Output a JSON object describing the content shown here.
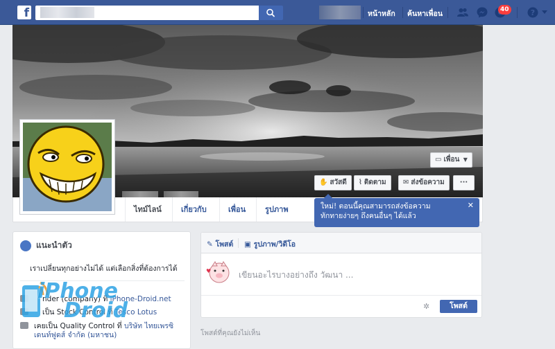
{
  "topbar": {
    "logo": "f",
    "home": "หน้าหลัก",
    "find_friends": "ค้นหาเพื่อน",
    "notifications_count": "40",
    "icons": [
      "friend-requests-icon",
      "messenger-icon",
      "notifications-icon",
      "help-icon"
    ]
  },
  "cover": {
    "friend_button": "เพื่อน",
    "wave_button": "สวัสดี",
    "follow_button": "ติดตาม",
    "message_button": "ส่งข้อความ",
    "more_button": "···"
  },
  "timeline_nav": {
    "items": [
      "ไทม์ไลน์",
      "เกี่ยวกับ",
      "เพื่อน",
      "รูปภาพ"
    ]
  },
  "tooltip": {
    "text_line1": "ใหม่! ตอนนี้คุณสามารถส่งข้อความ",
    "text_line2": "ทักทายง่ายๆ ถึงคนอื่นๆ ได้แล้ว",
    "close": "✕"
  },
  "intro": {
    "title": "แนะนำตัว",
    "bio": "เราเปลี่ยนทุกอย่างไม่ได้ แต่เลือกสิ่งที่ต้องการได้",
    "line1_prefix": "nder (company) ที่",
    "line1_link": "iPhone-Droid.net",
    "line2_prefix": "เป็น Stock Control ที่",
    "line2_link": "Tesco Lotus",
    "line3_prefix": "เคยเป็น Quality Control ที่",
    "line3_link": "บริษัท ไทยเพรซิ",
    "line4": "เดนท์ฟูดส์ จำกัด (มหาชน)"
  },
  "composer": {
    "tab_post": "โพสต์",
    "tab_photo": "รูปภาพ/วิดีโอ",
    "placeholder": "เขียนอะไรบางอย่างถึง วัฒนา ...",
    "post_button": "โพสต์",
    "unseen_label": "โพสต์ที่คุณยังไม่เห็น"
  },
  "watermark": {
    "line1": "iPhone",
    "line2": "Droid"
  },
  "colors": {
    "brand": "#3b5998",
    "button": "#4267b2",
    "link": "#365899",
    "badge": "#fa3e3e"
  }
}
